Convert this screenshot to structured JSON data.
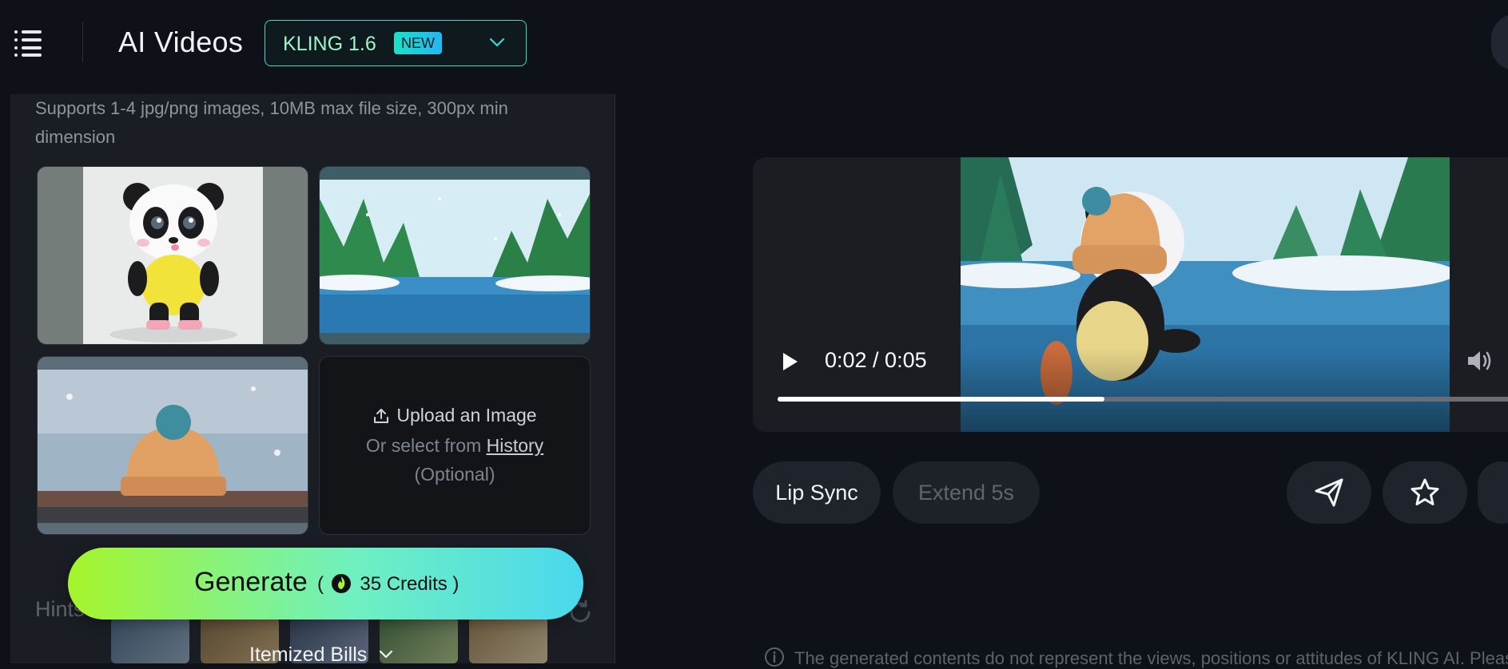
{
  "header": {
    "title": "AI Videos",
    "model": {
      "name": "KLING 1.6",
      "badge": "NEW"
    }
  },
  "left_panel": {
    "support_text": "Supports 1-4 jpg/png images, 10MB max file size, 300px min dimension",
    "upload": {
      "label": "Upload an Image",
      "or_text": "Or select from",
      "history_link": "History",
      "optional": "(Optional)"
    },
    "hints_label": "Hints",
    "generate": {
      "label": "Generate",
      "credits_prefix": "(",
      "credits": "35",
      "credits_unit": "Credits",
      "credits_suffix": ")"
    },
    "itemized_bills": "Itemized Bills"
  },
  "player": {
    "time": "0:02 / 0:05",
    "progress": 0.44
  },
  "actions": {
    "lip_sync": "Lip Sync",
    "extend": "Extend 5s"
  },
  "disclaimer": "The generated contents do not represent the views, positions or attitudes of KLING AI. Please",
  "colors": {
    "accent": "#3fd9c9",
    "generate_start": "#a6f52a",
    "generate_end": "#4ad8ee",
    "background": "#0e1117"
  }
}
